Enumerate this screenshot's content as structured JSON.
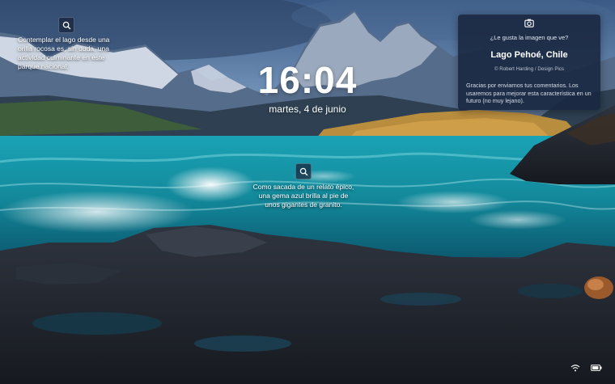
{
  "lock_screen": {
    "time": "16:04",
    "date": "martes, 4 de junio"
  },
  "hotspots": [
    {
      "text": "Contemplar el lago desde una orilla rocosa es, sin duda, una actividad culminante en este parque nacional.",
      "icon": "search-icon"
    },
    {
      "text": "Como sacada de un relato épico, una gema azul brilla al pie de unos gigantes de granito.",
      "icon": "search-icon"
    }
  ],
  "spotlight_card": {
    "icon": "camera-icon",
    "question": "¿Le gusta la imagen que ve?",
    "title": "Lago Pehoé, Chile",
    "credit": "© Robert Harding / Design Pics",
    "feedback": "Gracias por enviarnos tus comentarios. Los usaremos para mejorar esta característica en un futuro (no muy lejano)."
  },
  "status_tray": {
    "network_icon": "wifi-icon",
    "battery_icon": "battery-icon"
  },
  "colors": {
    "card_background": "#1a2840",
    "text": "#ffffff",
    "lake": "#1aa3b5"
  }
}
